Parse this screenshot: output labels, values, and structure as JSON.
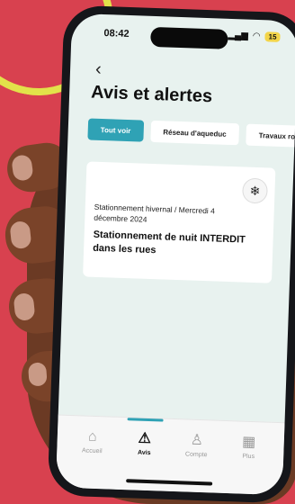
{
  "status_bar": {
    "time": "08:42",
    "battery": "15"
  },
  "header": {
    "back_icon": "chevron-left-icon",
    "title": "Avis et alertes"
  },
  "tabs": [
    {
      "label": "Tout voir",
      "active": true
    },
    {
      "label": "Réseau d'aqueduc",
      "active": false
    },
    {
      "label": "Travaux routie",
      "active": false
    }
  ],
  "alert_card": {
    "icon": "snowflake-icon",
    "meta": "Stationnement hivernal / Mercredi 4 décembre 2024",
    "headline": "Stationnement de nuit INTERDIT dans les rues"
  },
  "bottom_nav": [
    {
      "label": "Accueil",
      "icon": "home-icon",
      "active": false
    },
    {
      "label": "Avis",
      "icon": "warning-icon",
      "active": true
    },
    {
      "label": "Compte",
      "icon": "user-icon",
      "active": false
    },
    {
      "label": "Plus",
      "icon": "grid-icon",
      "active": false
    }
  ],
  "colors": {
    "background": "#d8414f",
    "accent": "#2fa2b5",
    "screen": "#e8f2ef"
  }
}
